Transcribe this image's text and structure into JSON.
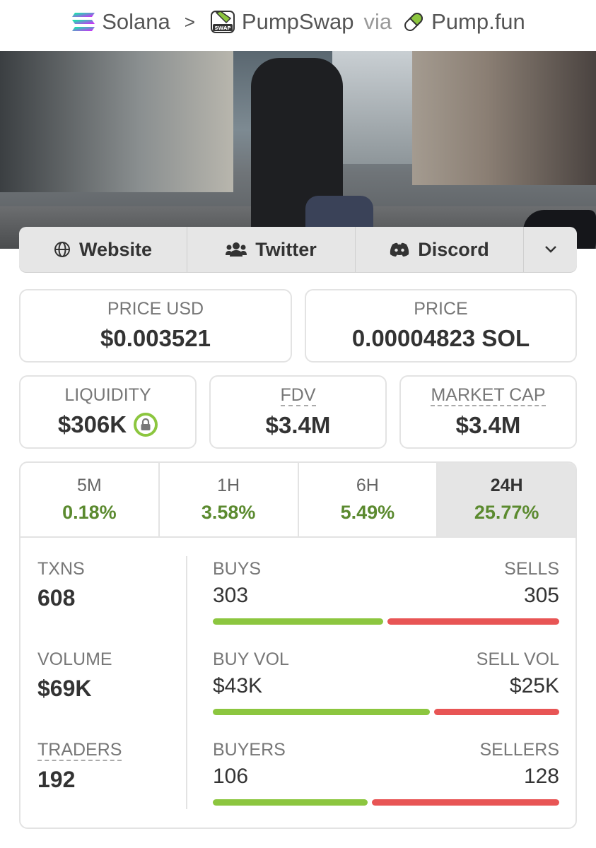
{
  "breadcrumb": {
    "chain": "Solana",
    "dex": "PumpSwap",
    "dex_icon_text": "SWAP",
    "via": "via",
    "launchpad": "Pump.fun"
  },
  "links": {
    "website": "Website",
    "twitter": "Twitter",
    "discord": "Discord"
  },
  "prices": {
    "price_usd_label": "PRICE USD",
    "price_usd": "$0.003521",
    "price_label": "PRICE",
    "price_sol": "0.00004823 SOL"
  },
  "metrics": {
    "liquidity_label": "LIQUIDITY",
    "liquidity": "$306K",
    "fdv_label": "FDV",
    "fdv": "$3.4M",
    "mcap_label": "MARKET CAP",
    "mcap": "$3.4M"
  },
  "tabs": [
    {
      "label": "5M",
      "value": "0.18%"
    },
    {
      "label": "1H",
      "value": "3.58%"
    },
    {
      "label": "6H",
      "value": "5.49%"
    },
    {
      "label": "24H",
      "value": "25.77%"
    }
  ],
  "active_tab": "24H",
  "stats": {
    "txns_label": "TXNS",
    "txns": "608",
    "volume_label": "VOLUME",
    "volume": "$69K",
    "traders_label": "TRADERS",
    "traders": "192"
  },
  "rows": [
    {
      "left_label": "BUYS",
      "right_label": "SELLS",
      "left_value": "303",
      "right_value": "305",
      "buy_fraction": 0.498
    },
    {
      "left_label": "BUY VOL",
      "right_label": "SELL VOL",
      "left_value": "$43K",
      "right_value": "$25K",
      "buy_fraction": 0.632
    },
    {
      "left_label": "BUYERS",
      "right_label": "SELLERS",
      "left_value": "106",
      "right_value": "128",
      "buy_fraction": 0.453
    }
  ],
  "colors": {
    "positive": "#5b8a2f",
    "buy_bar": "#8cc63f",
    "sell_bar": "#e85555"
  }
}
